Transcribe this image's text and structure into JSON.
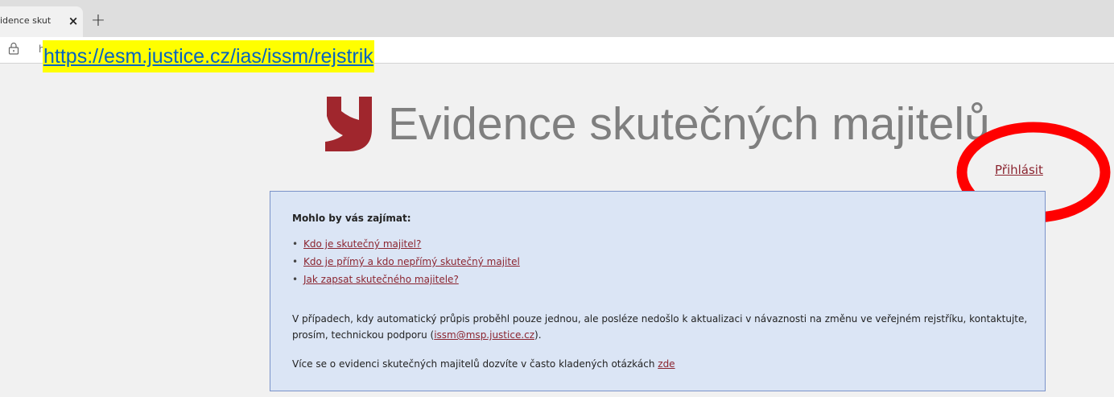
{
  "browser": {
    "tab_title": "idence skut",
    "tab_close": "×",
    "new_tab": "+",
    "url_faint": "h",
    "url_highlight": "https://esm.justice.cz/ias/issm/rejstrik"
  },
  "header": {
    "title": "Evidence skutečných majitelů",
    "login_link": "Přihlásit",
    "brand_color": "#a0262d"
  },
  "info_box": {
    "heading": "Mohlo by vás zajímat:",
    "links": [
      {
        "label": "Kdo je skutečný majitel?"
      },
      {
        "label": "Kdo je přímý a kdo nepřímý skutečný majitel"
      },
      {
        "label": "Jak zapsat skutečného majitele?"
      }
    ],
    "para1_text": "V případech, kdy automatický průpis proběhl pouze jednou, ale posléze nedošlo k aktualizaci v návaznosti na změnu ve veřejném rejstříku, kontaktujte, prosím, technickou podporu (",
    "para1_email": "issm@msp.justice.cz",
    "para1_end": ").",
    "para2_text": "Více se o evidenci skutečných majitelů dozvíte v často kladených otázkách ",
    "para2_link": "zde"
  },
  "annotation": {
    "color": "#ff0000"
  }
}
